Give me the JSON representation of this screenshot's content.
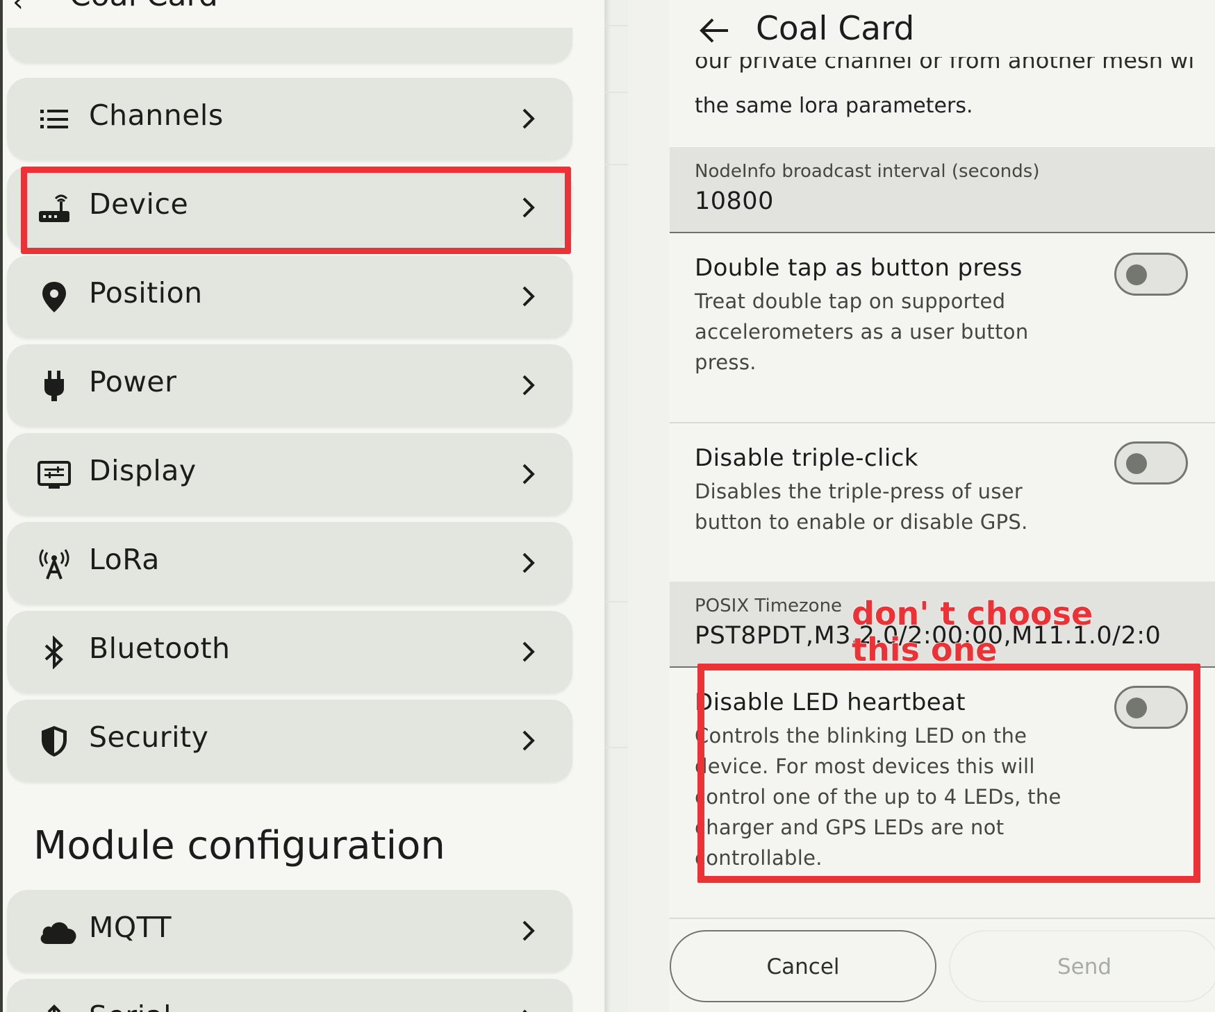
{
  "left_panel": {
    "cut_title": "Coal Card",
    "items": [
      {
        "label": "Channels",
        "icon": "list-icon"
      },
      {
        "label": "Device",
        "icon": "router-icon"
      },
      {
        "label": "Position",
        "icon": "location-pin-icon"
      },
      {
        "label": "Power",
        "icon": "power-plug-icon"
      },
      {
        "label": "Display",
        "icon": "display-icon"
      },
      {
        "label": "LoRa",
        "icon": "antenna-icon"
      },
      {
        "label": "Bluetooth",
        "icon": "bluetooth-icon"
      },
      {
        "label": "Security",
        "icon": "shield-icon"
      }
    ],
    "module_heading": "Module configuration",
    "module_items": [
      {
        "label": "MQTT",
        "icon": "cloud-icon"
      },
      {
        "label": "Serial",
        "icon": "serial-icon"
      }
    ]
  },
  "dialog": {
    "title": "Coal Card",
    "description_cut": "our private channel or from another mesh with",
    "description_tail": "the same lora parameters.",
    "nodeinfo_field": {
      "label": "NodeInfo broadcast interval (seconds)",
      "value": "10800"
    },
    "double_tap": {
      "title": "Double tap as button press",
      "description": "Treat double tap on supported accelerometers as a user button press.",
      "enabled": false
    },
    "triple_click": {
      "title": "Disable triple-click",
      "description": "Disables the triple-press of user button to enable or disable GPS.",
      "enabled": false
    },
    "posix_field": {
      "label": "POSIX Timezone",
      "value": "PST8PDT,M3.2.0/2:00:00,M11.1.0/2:0"
    },
    "led_heartbeat": {
      "title": "Disable LED heartbeat",
      "description": "Controls the blinking LED on the device. For most devices this will control one of the up to 4 LEDs, the charger and GPS LEDs are not controllable.",
      "enabled": false
    },
    "cancel_label": "Cancel",
    "send_label": "Send"
  },
  "annotation": {
    "text": "don' t choose this one",
    "color": "#ec3237"
  },
  "colors": {
    "card_bg": "#e3e5df",
    "annotation_red": "#ec3237"
  }
}
